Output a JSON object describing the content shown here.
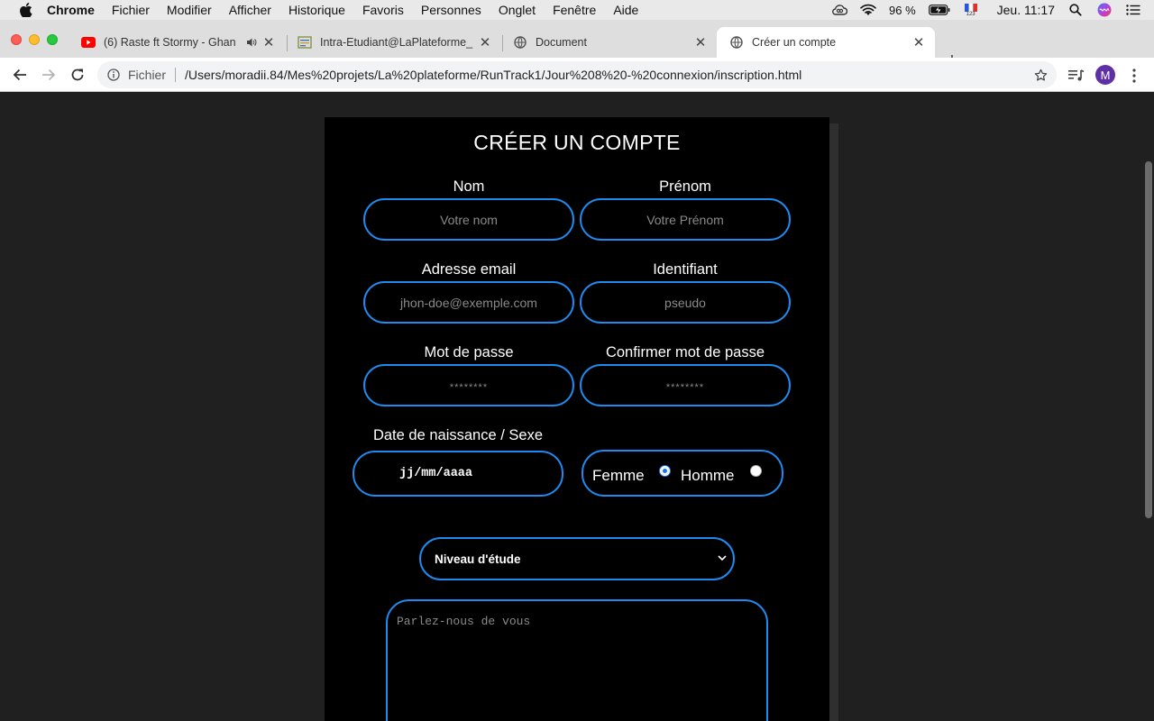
{
  "menubar": {
    "app": "Chrome",
    "items": [
      "Fichier",
      "Modifier",
      "Afficher",
      "Historique",
      "Favoris",
      "Personnes",
      "Onglet",
      "Fenêtre",
      "Aide"
    ],
    "battery": "96 %",
    "keyboard_flag_sub": "123",
    "clock": "Jeu. 11:17",
    "icons": [
      "apple-icon",
      "creative-cloud-icon",
      "wifi-icon",
      "battery-icon",
      "keyboard-flag-icon",
      "spotlight-icon",
      "siri-icon",
      "control-center-icon"
    ]
  },
  "tabs": [
    {
      "title": "(6) Raste ft Stormy - Ghan",
      "icon": "youtube-icon",
      "playing_audio": true,
      "active": false
    },
    {
      "title": "Intra-Etudiant@LaPlateforme_",
      "icon": "site-favicon",
      "active": false
    },
    {
      "title": "Document",
      "icon": "globe-icon",
      "active": false
    },
    {
      "title": "Créer un compte",
      "icon": "globe-icon",
      "active": true
    }
  ],
  "toolbar": {
    "scheme": "Fichier",
    "url": "/Users/moradii.84/Mes%20projets/La%20plateforme/RunTrack1/Jour%208%20-%20connexion/inscription.html",
    "avatar": "M"
  },
  "form": {
    "title": "CRÉER UN COMPTE",
    "nom_label": "Nom",
    "nom_placeholder": "Votre nom",
    "prenom_label": "Prénom",
    "prenom_placeholder": "Votre Prénom",
    "email_label": "Adresse email",
    "email_placeholder": "jhon-doe@exemple.com",
    "identifiant_label": "Identifiant",
    "identifiant_placeholder": "pseudo",
    "password_label": "Mot de passe",
    "password_placeholder": "********",
    "confirm_label": "Confirmer mot de passe",
    "confirm_placeholder": "********",
    "birth_sex_label": "Date de naissance / Sexe",
    "date_placeholder": "jj/mm/aaaa",
    "sex_female": "Femme",
    "sex_male": "Homme",
    "sex_selected": "Femme",
    "level_select": "Niveau d'étude",
    "about_placeholder": "Parlez-nous de vous"
  },
  "colors": {
    "accent": "#1f8bf0",
    "card_bg": "#000000",
    "page_bg": "#202020"
  }
}
